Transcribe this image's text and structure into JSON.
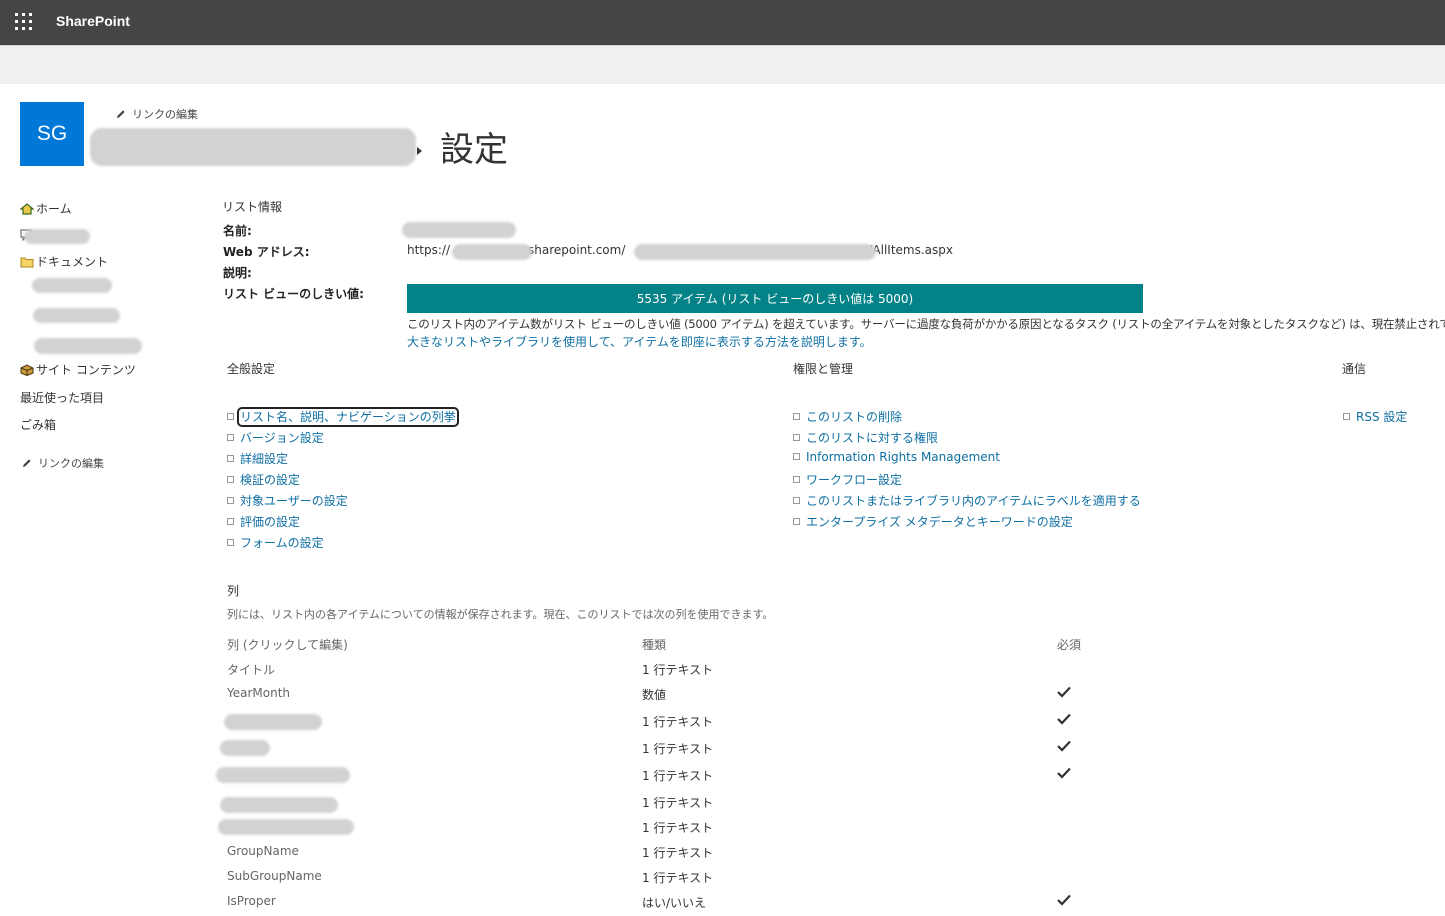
{
  "suite_bar": {
    "brand": "SharePoint"
  },
  "site": {
    "logo_initials": "SG",
    "edit_links": "リンクの編集",
    "page_title": "設定"
  },
  "left_nav": {
    "items": [
      "ホーム",
      "ドキュメント",
      "サイト コンテンツ",
      "最近使った項目",
      "ごみ箱"
    ],
    "edit_links": "リンクの編集"
  },
  "list_info": {
    "heading": "リスト情報",
    "name_label": "名前:",
    "web_address_label": "Web アドレス:",
    "url_prefix": "https://",
    "url_mid": "sharepoint.com/",
    "url_suffix": "/AllItems.aspx",
    "description_label": "説明:",
    "threshold_label": "リスト ビューのしきい値:",
    "threshold_bar_text": "5535 アイテム (リスト ビューのしきい値は 5000)",
    "threshold_message": "このリスト内のアイテム数がリスト ビューのしきい値 (5000 アイテム) を超えています。サーバーに過度な負荷がかかる原因となるタスク (リストの全アイテムを対象としたタスクなど) は、現在禁止されています。",
    "threshold_link": "大きなリストやライブラリを使用して、アイテムを即座に表示する方法を説明します。"
  },
  "sections": {
    "general": {
      "heading": "全般設定",
      "items": [
        "リスト名、説明、ナビゲーションの列挙",
        "バージョン設定",
        "詳細設定",
        "検証の設定",
        "対象ユーザーの設定",
        "評価の設定",
        "フォームの設定"
      ]
    },
    "permissions": {
      "heading": "権限と管理",
      "items": [
        "このリストの削除",
        "このリストに対する権限",
        "Information Rights Management",
        "ワークフロー設定",
        "このリストまたはライブラリ内のアイテムにラベルを適用する",
        "エンタープライズ メタデータとキーワードの設定"
      ]
    },
    "communication": {
      "heading": "通信",
      "items": [
        "RSS 設定"
      ]
    }
  },
  "columns": {
    "heading": "列",
    "description": "列には、リスト内の各アイテムについての情報が保存されます。現在、このリストでは次の列を使用できます。",
    "headers": {
      "column": "列 (クリックして編集)",
      "type": "種類",
      "required": "必須"
    },
    "rows": [
      {
        "name": "タイトル",
        "type": "1 行テキスト",
        "required": false
      },
      {
        "name": "YearMonth",
        "type": "数値",
        "required": true
      },
      {
        "name": "",
        "type": "1 行テキスト",
        "required": true
      },
      {
        "name": "",
        "type": "1 行テキスト",
        "required": true
      },
      {
        "name": "",
        "type": "1 行テキスト",
        "required": true
      },
      {
        "name": "",
        "type": "1 行テキスト",
        "required": false
      },
      {
        "name": "",
        "type": "1 行テキスト",
        "required": false
      },
      {
        "name": "GroupName",
        "type": "1 行テキスト",
        "required": false
      },
      {
        "name": "SubGroupName",
        "type": "1 行テキスト",
        "required": false
      },
      {
        "name": "IsProper",
        "type": "はい/いいえ",
        "required": true
      }
    ]
  },
  "colors": {
    "suite_bar": "#464544",
    "logo": "#0078d7",
    "threshold_bar": "#038387",
    "link": "#0f6fa3"
  },
  "icons": [
    "waffle-icon",
    "pencil-icon",
    "home-icon",
    "chat-icon",
    "folder-icon",
    "box-icon",
    "checkmark-icon"
  ]
}
